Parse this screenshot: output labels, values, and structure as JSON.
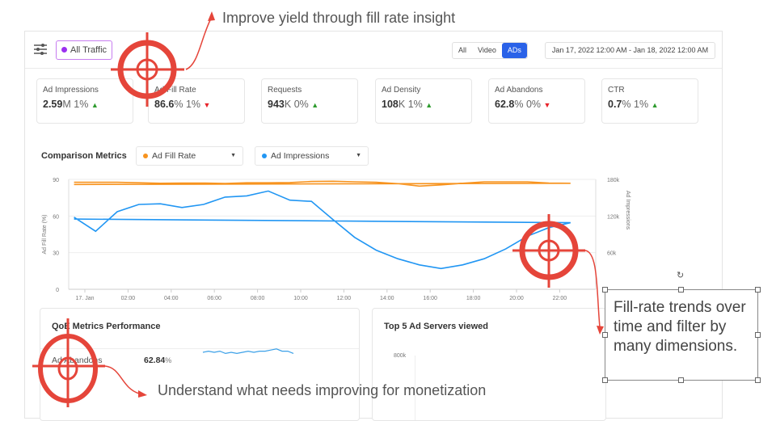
{
  "annotations": {
    "top": "Improve yield through fill rate insight",
    "bottom": "Understand what needs improving for monetization",
    "textbox": "Fill-rate trends over time and filter by many dimensions.",
    "accent": "#e5453a"
  },
  "header": {
    "filter_icon": "sliders-icon",
    "segment": "All Traffic",
    "segment_color": "#9b30f0",
    "tabs": [
      {
        "label": "All"
      },
      {
        "label": "Video"
      },
      {
        "label": "ADs",
        "active": true
      }
    ],
    "date_range": "Jan 17, 2022 12:00 AM - Jan 18, 2022 12:00 AM"
  },
  "metrics": [
    {
      "title": "Ad Impressions",
      "value": "2.59",
      "unit": "M",
      "change": "1%",
      "trend": "up"
    },
    {
      "title": "Ad Fill Rate",
      "value": "86.6",
      "unit": "%",
      "change": "1%",
      "trend": "down"
    },
    {
      "title": "Requests",
      "value": "943",
      "unit": "K",
      "change": "0%",
      "trend": "up"
    },
    {
      "title": "Ad Density",
      "value": "108",
      "unit": "K",
      "change": "1%",
      "trend": "up"
    },
    {
      "title": "Ad Abandons",
      "value": "62.8",
      "unit": "%",
      "change": "0%",
      "trend": "down"
    },
    {
      "title": "CTR",
      "value": "0.7",
      "unit": "%",
      "change": "1%",
      "trend": "up"
    }
  ],
  "comparison": {
    "label": "Comparison Metrics",
    "metric1": {
      "label": "Ad Fill Rate",
      "color": "#f7931e"
    },
    "metric2": {
      "label": "Ad Impressions",
      "color": "#2196f3"
    }
  },
  "chart_data": {
    "type": "line",
    "x": [
      "23:30",
      "00:30",
      "01:30",
      "02:30",
      "03:30",
      "04:30",
      "05:30",
      "06:30",
      "07:30",
      "08:30",
      "09:30",
      "10:30",
      "11:30",
      "12:30",
      "13:30",
      "14:30",
      "15:30",
      "16:30",
      "17:30",
      "18:30",
      "19:30",
      "20:30",
      "21:30",
      "22:30",
      "23:30"
    ],
    "x_ticks": [
      "17. Jan",
      "02:00",
      "04:00",
      "06:00",
      "08:00",
      "10:00",
      "12:00",
      "14:00",
      "16:00",
      "18:00",
      "20:00",
      "22:00"
    ],
    "ylabel": "Ad Fill Rate (%)",
    "y2label": "Ad Impressions",
    "ylim": [
      0,
      90
    ],
    "y_ticks": [
      "0",
      "30",
      "60",
      "90"
    ],
    "y2lim": [
      0,
      180000
    ],
    "y2_ticks": [
      "60k",
      "120k",
      "180k"
    ],
    "grid": true,
    "series": [
      {
        "name": "Ad Fill Rate",
        "axis": "left",
        "color": "#f7931e",
        "values": [
          87.6,
          87.6,
          87.6,
          87.2,
          86.8,
          87,
          87,
          86.6,
          87.2,
          87.2,
          87.4,
          88.3,
          88.5,
          88,
          87.6,
          86.5,
          84.5,
          85.5,
          86.8,
          88,
          88,
          88,
          87,
          86.8,
          85.8
        ]
      },
      {
        "name": "Ad Impressions",
        "axis": "right",
        "color": "#2196f3",
        "values": [
          118000,
          95000,
          127000,
          139000,
          140000,
          134000,
          139000,
          151000,
          153000,
          161000,
          146000,
          144000,
          114000,
          85000,
          64000,
          50000,
          40000,
          34000,
          40000,
          50000,
          66000,
          87000,
          101000,
          109000,
          115000
        ]
      }
    ]
  },
  "qoe": {
    "title": "QoE Metrics Performance",
    "row_label": "Ad Abandons",
    "row_value": "62.84",
    "row_unit": "%",
    "sparkline": [
      5,
      6,
      5,
      6,
      4,
      5,
      4,
      5,
      6,
      5,
      6,
      6,
      7,
      8,
      6,
      6,
      4
    ]
  },
  "servers": {
    "title": "Top 5 Ad Servers viewed",
    "y_tick": "800k"
  }
}
